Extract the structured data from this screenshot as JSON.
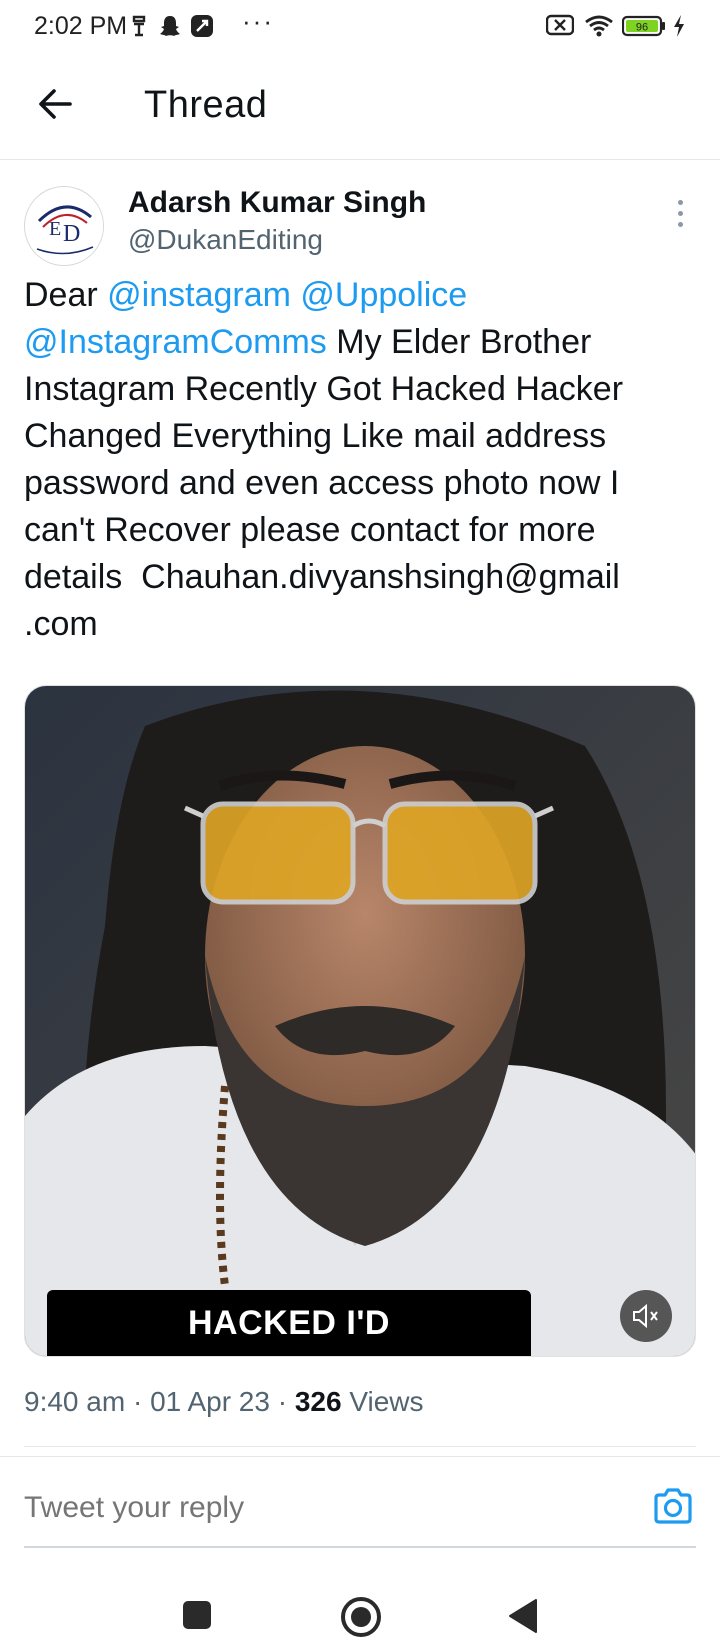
{
  "status_bar": {
    "time": "2:02 PM",
    "more": "···",
    "battery": "96"
  },
  "header": {
    "title": "Thread"
  },
  "tweet": {
    "author_name": "Adarsh Kumar Singh",
    "author_handle": "@DukanEditing",
    "text_prefix": "Dear ",
    "mentions": [
      "@instagram",
      "@Uppolice",
      "@InstagramComms"
    ],
    "text_body": " My Elder Brother Instagram Recently Got Hacked Hacker Changed Everything Like mail address password and even access photo now I can't Recover please contact for more details  Chauhan.divyanshsingh@gmail\n.com",
    "media_caption": "HACKED I'D",
    "time": "9:40 am",
    "date": "01 Apr 23",
    "views_count": "326",
    "views_label": "Views"
  },
  "reply": {
    "placeholder": "Tweet your reply"
  },
  "colors": {
    "accent": "#1d9bf0",
    "text": "#0f1419",
    "muted": "#536471",
    "battery": "#7ed321"
  }
}
